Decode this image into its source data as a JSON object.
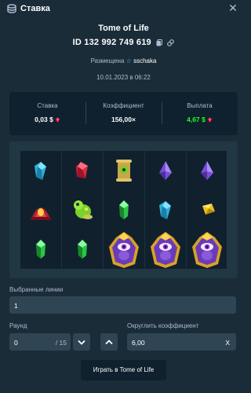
{
  "header": {
    "title": "Ставка",
    "close_icon": "close-icon",
    "bet_icon": "coins-icon"
  },
  "bet": {
    "game_title": "Tome of Life",
    "id_label": "ID 132 992 749 619",
    "placed_prefix": "Размещена",
    "user": "sschaka",
    "date": "10.01.2023 в 06:22"
  },
  "stats": {
    "bet_label": "Ставка",
    "bet_value": "0,03 $",
    "multiplier_label": "Коэффициент",
    "multiplier_value": "156,00×",
    "payout_label": "Выплата",
    "payout_value": "4,67 $",
    "currency_icon": "ruby-gem-icon",
    "payout_color": "#1fff20"
  },
  "board": {
    "grid": [
      [
        "blue-crystal",
        "red-crystal",
        "gold-scroll",
        "purple-crystal",
        "purple-crystal"
      ],
      [
        "red-helmet",
        "green-creature",
        "green-crystal",
        "blue-crystal",
        "yellow-crystal"
      ],
      [
        "green-crystal",
        "green-crystal",
        "purple-eye-idol",
        "purple-eye-idol",
        "purple-eye-idol"
      ]
    ]
  },
  "lines": {
    "label": "Выбранные линии",
    "value": "1"
  },
  "round": {
    "label": "Раунд",
    "value": "0",
    "total": "/ 15",
    "down_icon": "chevron-down-icon",
    "up_icon": "chevron-up-icon"
  },
  "round_multiplier": {
    "label": "Округлить коэффициент",
    "value": "6,00",
    "clear_symbol": "X"
  },
  "play_button": {
    "label": "Играть в Tome of Life"
  }
}
